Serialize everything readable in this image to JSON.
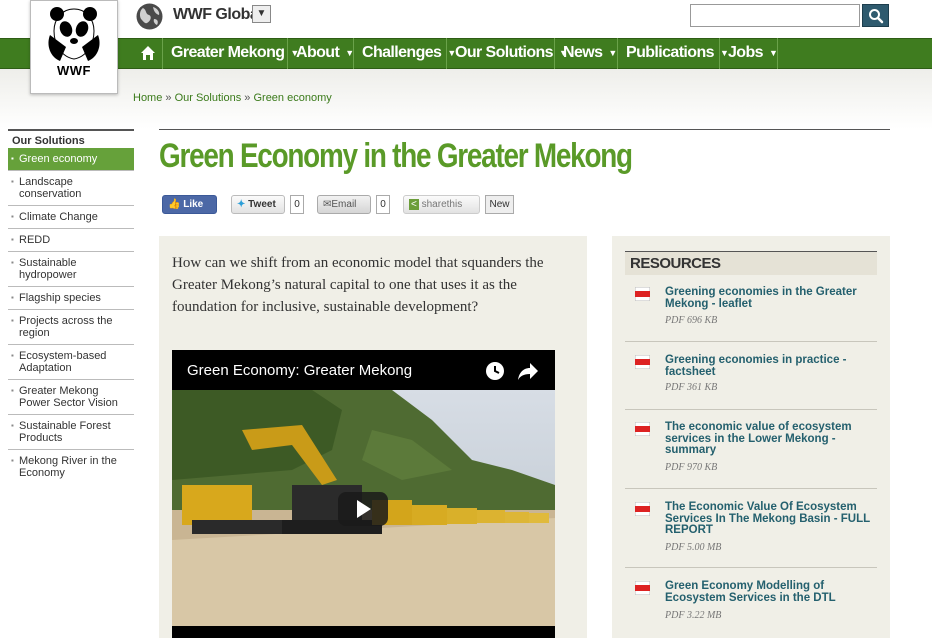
{
  "header": {
    "logo_text": "WWF",
    "site_name": "WWF Global",
    "site_dropdown_glyph": "▼",
    "search": {
      "value": "",
      "placeholder": ""
    }
  },
  "nav": {
    "items": [
      {
        "label": "Greater Mekong"
      },
      {
        "label": "About"
      },
      {
        "label": "Challenges"
      },
      {
        "label": "Our Solutions"
      },
      {
        "label": "News"
      },
      {
        "label": "Publications"
      },
      {
        "label": "Jobs"
      }
    ],
    "caret": "▼"
  },
  "breadcrumb": {
    "home": "Home",
    "sep": " » ",
    "parent": "Our Solutions",
    "current": "Green economy"
  },
  "sidebar": {
    "heading": "Our Solutions",
    "items": [
      {
        "label": "Green economy",
        "active": true
      },
      {
        "label": "Landscape conservation"
      },
      {
        "label": "Climate Change"
      },
      {
        "label": "REDD"
      },
      {
        "label": "Sustainable hydropower"
      },
      {
        "label": "Flagship species"
      },
      {
        "label": "Projects across the region"
      },
      {
        "label": "Ecosystem-based Adaptation"
      },
      {
        "label": "Greater Mekong Power Sector Vision"
      },
      {
        "label": "Sustainable Forest Products"
      },
      {
        "label": "Mekong River in the Economy"
      }
    ]
  },
  "page": {
    "title": "Green Economy in the Greater Mekong",
    "intro": "How can we shift from an economic model that squanders the Greater Mekong’s natural capital to one that uses it as the foundation for inclusive, sustainable development?"
  },
  "share": {
    "like_label": "Like 0",
    "tweet_label": "Tweet",
    "tweet_count": "0",
    "email_label": "Email",
    "email_count": "0",
    "sharethis_label": "sharethis",
    "new_badge": "New"
  },
  "video": {
    "title": "Green Economy: Greater Mekong"
  },
  "resources": {
    "heading": "RESOURCES",
    "items": [
      {
        "title": "Greening economies in the Greater Mekong - leaflet",
        "meta": "PDF 696 KB"
      },
      {
        "title": "Greening economies in practice - factsheet",
        "meta": "PDF 361 KB"
      },
      {
        "title": "The economic value of ecosystem services in the Lower Mekong - summary",
        "meta": "PDF 970 KB"
      },
      {
        "title": "The Economic Value Of Ecosystem Services In The Mekong Basin - FULL REPORT",
        "meta": "PDF 5.00 MB"
      },
      {
        "title": "Green Economy Modelling of Ecosystem Services in the DTL",
        "meta": "PDF 3.22 MB"
      }
    ],
    "pdf_icon_label": "PDF"
  },
  "colors": {
    "nav_green": "#3f7c1f",
    "title_green": "#5a9a28",
    "active_green": "#66a13a",
    "link_teal": "#24606e",
    "panel_beige": "#f0efe7"
  },
  "icons": [
    "panda-logo",
    "globe-icon",
    "search-icon",
    "home-icon",
    "clock-icon",
    "share-arrow-icon",
    "play-icon",
    "pdf-icon",
    "facebook-icon",
    "twitter-icon",
    "email-icon",
    "sharethis-icon"
  ]
}
